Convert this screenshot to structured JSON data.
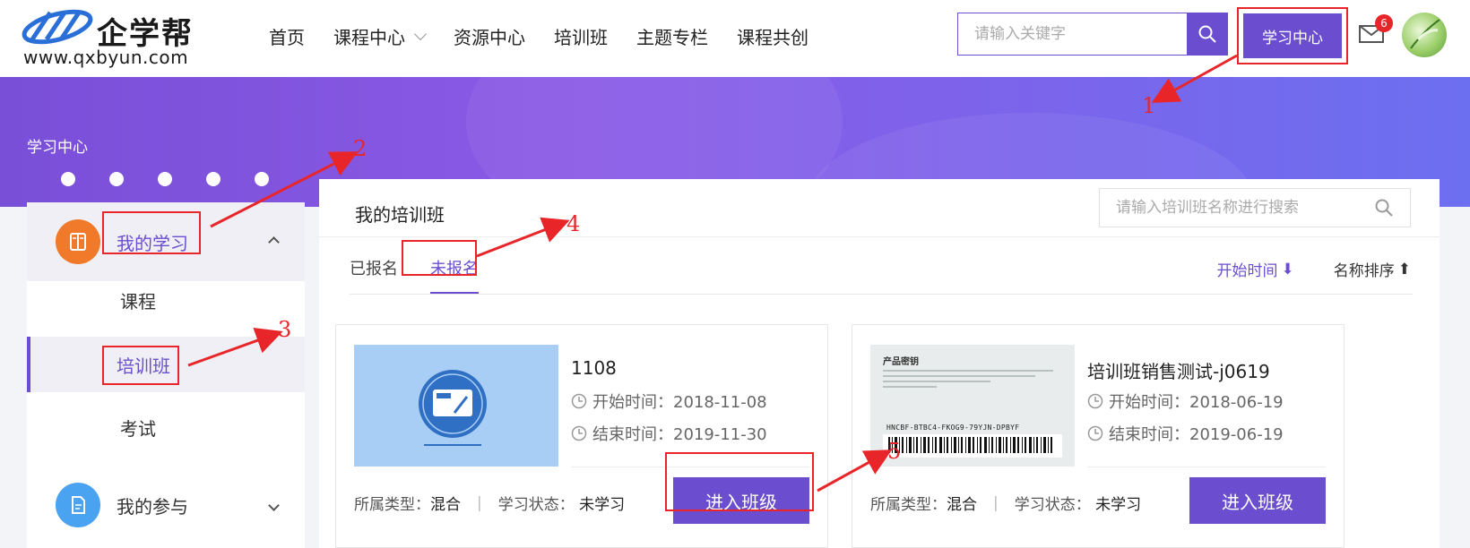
{
  "header": {
    "logo_text": "企学帮",
    "logo_url": "www.qxbyun.com",
    "nav": [
      {
        "label": "首页"
      },
      {
        "label": "课程中心"
      },
      {
        "label": "资源中心"
      },
      {
        "label": "培训班"
      },
      {
        "label": "主题专栏"
      },
      {
        "label": "课程共创"
      }
    ],
    "search_placeholder": "请输入关键字",
    "study_center": "学习中心",
    "mail_badge": "6"
  },
  "banner": {
    "title": "学习中心"
  },
  "sidebar": {
    "groups": [
      {
        "label": "我的学习",
        "icon": "book-icon",
        "color": "#f07a2a",
        "expanded": true,
        "items": [
          {
            "label": "课程"
          },
          {
            "label": "培训班"
          },
          {
            "label": "考试"
          }
        ]
      },
      {
        "label": "我的参与",
        "icon": "document-icon",
        "color": "#4aa3f0",
        "expanded": false
      }
    ]
  },
  "main": {
    "title": "我的培训班",
    "search_placeholder": "请输入培训班名称进行搜索",
    "tabs": [
      {
        "label": "已报名"
      },
      {
        "label": "未报名"
      }
    ],
    "sorts": [
      {
        "label": "开始时间",
        "arrow": "⬇"
      },
      {
        "label": "名称排序",
        "arrow": "⬆"
      }
    ],
    "cards": [
      {
        "name": "1108",
        "start": "开始时间：2018-11-08",
        "end": "结束时间：2019-11-30",
        "type_label": "所属类型：",
        "type_value": "混合",
        "status_label": "学习状态：",
        "status_value": "未学习",
        "button": "进入班级",
        "thumb_color": "#a9cef5"
      },
      {
        "name": "培训班销售测试-j0619",
        "start": "开始时间：2018-06-19",
        "end": "结束时间：2019-06-19",
        "type_label": "所属类型：",
        "type_value": "混合",
        "status_label": "学习状态：",
        "status_value": "未学习",
        "button": "进入班级",
        "thumb_title": "产品密钥",
        "thumb_key": "HNCBF-BTBC4-FKOG9-79YJN-DPBYF"
      }
    ]
  },
  "annotations": [
    "1",
    "2",
    "3",
    "4",
    "5"
  ],
  "colors": {
    "accent": "#6b4ed0",
    "highlight": "#e8262a"
  }
}
